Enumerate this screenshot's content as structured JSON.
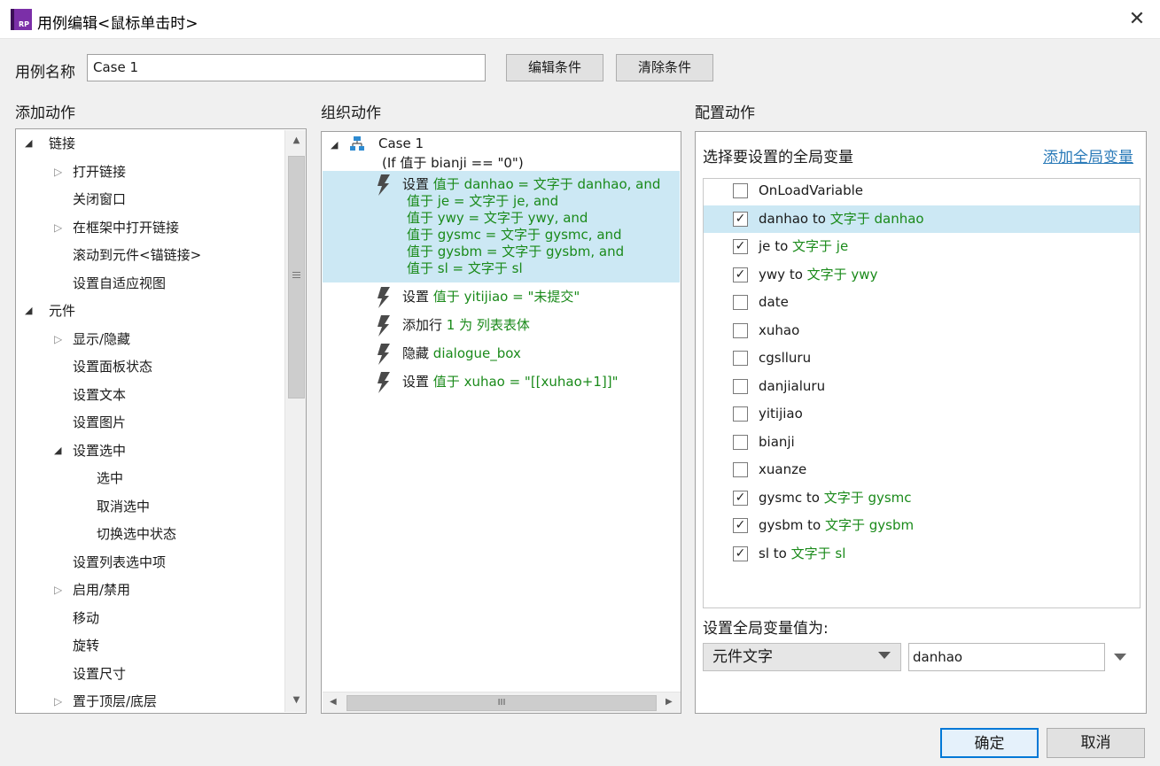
{
  "window": {
    "title": "用例编辑<鼠标单击时>",
    "icon_text": "RP",
    "close_glyph": "✕"
  },
  "case_name": {
    "label": "用例名称",
    "value": "Case 1"
  },
  "buttons": {
    "edit_condition": "编辑条件",
    "clear_condition": "清除条件",
    "ok": "确定",
    "cancel": "取消"
  },
  "add_actions": {
    "title": "添加动作",
    "items": [
      {
        "label": "链接",
        "level": 0,
        "expander": "open"
      },
      {
        "label": "打开链接",
        "level": 1,
        "expander": "closed"
      },
      {
        "label": "关闭窗口",
        "level": 1,
        "expander": "none"
      },
      {
        "label": "在框架中打开链接",
        "level": 1,
        "expander": "closed"
      },
      {
        "label": "滚动到元件<锚链接>",
        "level": 1,
        "expander": "none"
      },
      {
        "label": "设置自适应视图",
        "level": 1,
        "expander": "none"
      },
      {
        "label": "元件",
        "level": 0,
        "expander": "open"
      },
      {
        "label": "显示/隐藏",
        "level": 1,
        "expander": "closed"
      },
      {
        "label": "设置面板状态",
        "level": 1,
        "expander": "none"
      },
      {
        "label": "设置文本",
        "level": 1,
        "expander": "none"
      },
      {
        "label": "设置图片",
        "level": 1,
        "expander": "none"
      },
      {
        "label": "设置选中",
        "level": 1,
        "expander": "open"
      },
      {
        "label": "选中",
        "level": 2,
        "expander": "none"
      },
      {
        "label": "取消选中",
        "level": 2,
        "expander": "none"
      },
      {
        "label": "切换选中状态",
        "level": 2,
        "expander": "none"
      },
      {
        "label": "设置列表选中项",
        "level": 1,
        "expander": "none"
      },
      {
        "label": "启用/禁用",
        "level": 1,
        "expander": "closed"
      },
      {
        "label": "移动",
        "level": 1,
        "expander": "none"
      },
      {
        "label": "旋转",
        "level": 1,
        "expander": "none"
      },
      {
        "label": "设置尺寸",
        "level": 1,
        "expander": "none"
      },
      {
        "label": "置于顶层/底层",
        "level": 1,
        "expander": "closed"
      }
    ]
  },
  "organize_actions": {
    "title": "组织动作",
    "case_label": "Case 1",
    "case_condition": "(If 值于 bianji == \"0\")",
    "actions": [
      {
        "verb": "设置",
        "lines": [
          "值于 danhao = 文字于 danhao, and",
          "值于 je = 文字于 je, and",
          "值于 ywy = 文字于 ywy, and",
          "值于 gysmc = 文字于 gysmc, and",
          "值于 gysbm = 文字于 gysbm, and",
          "值于 sl = 文字于 sl"
        ],
        "selected": true
      },
      {
        "verb": "设置",
        "lines": [
          "值于 yitijiao = \"未提交\""
        ],
        "selected": false
      },
      {
        "verb": "添加行",
        "lines": [
          "1 为 列表表体"
        ],
        "selected": false
      },
      {
        "verb": "隐藏",
        "lines": [
          "dialogue_box"
        ],
        "selected": false
      },
      {
        "verb": "设置",
        "lines": [
          "值于 xuhao = \"[[xuhao+1]]\""
        ],
        "selected": false
      }
    ],
    "hscroll_grip": "III"
  },
  "configure_actions": {
    "title": "配置动作",
    "subtitle": "选择要设置的全局变量",
    "add_global_link": "添加全局变量",
    "variables": [
      {
        "name": "OnLoadVariable",
        "checked": false,
        "to": "",
        "value": "",
        "selected": false
      },
      {
        "name": "danhao",
        "checked": true,
        "to": "to",
        "value": "文字于 danhao",
        "selected": true
      },
      {
        "name": "je",
        "checked": true,
        "to": "to",
        "value": "文字于 je",
        "selected": false
      },
      {
        "name": "ywy",
        "checked": true,
        "to": "to",
        "value": "文字于 ywy",
        "selected": false
      },
      {
        "name": "date",
        "checked": false,
        "to": "",
        "value": "",
        "selected": false
      },
      {
        "name": "xuhao",
        "checked": false,
        "to": "",
        "value": "",
        "selected": false
      },
      {
        "name": "cgslluru",
        "checked": false,
        "to": "",
        "value": "",
        "selected": false
      },
      {
        "name": "danjialuru",
        "checked": false,
        "to": "",
        "value": "",
        "selected": false
      },
      {
        "name": "yitijiao",
        "checked": false,
        "to": "",
        "value": "",
        "selected": false
      },
      {
        "name": "bianji",
        "checked": false,
        "to": "",
        "value": "",
        "selected": false
      },
      {
        "name": "xuanze",
        "checked": false,
        "to": "",
        "value": "",
        "selected": false
      },
      {
        "name": "gysmc",
        "checked": true,
        "to": "to",
        "value": "文字于 gysmc",
        "selected": false
      },
      {
        "name": "gysbm",
        "checked": true,
        "to": "to",
        "value": "文字于 gysbm",
        "selected": false
      },
      {
        "name": "sl",
        "checked": true,
        "to": "to",
        "value": "文字于 sl",
        "selected": false
      }
    ],
    "set_value_label": "设置全局变量值为:",
    "value_type": "元件文字",
    "value_text": "danhao"
  },
  "colors": {
    "accent": "#0078d7",
    "selection": "#cce8f4",
    "green_text": "#1a8a1a",
    "link": "#2a7ab8"
  }
}
